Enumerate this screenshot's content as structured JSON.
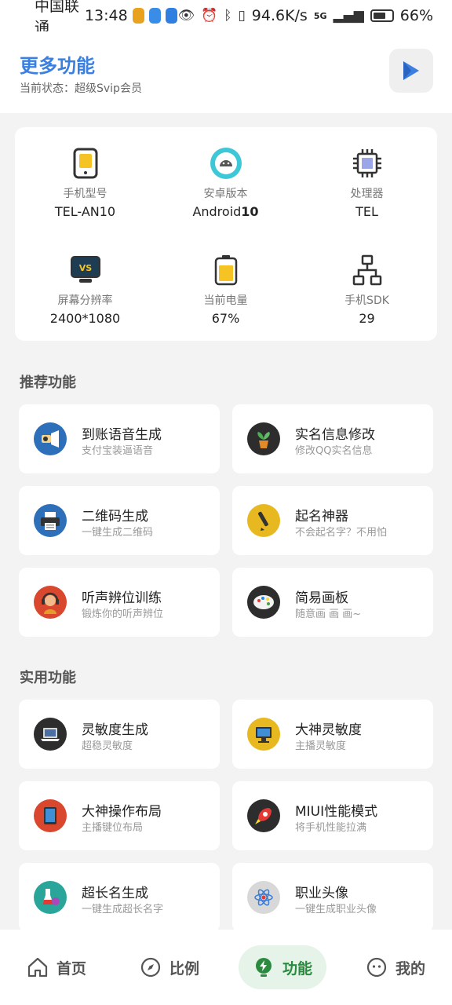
{
  "status_bar": {
    "carrier": "中国联通",
    "time": "13:48",
    "speed": "94.6K/s",
    "network": "5G",
    "battery": "66%"
  },
  "header": {
    "title": "更多功能",
    "subtitle": "当前状态：超级Svip会员"
  },
  "device_info": [
    {
      "label": "手机型号",
      "value": "TEL-AN10",
      "icon": "phone-icon"
    },
    {
      "label": "安卓版本",
      "value_prefix": "Android",
      "value_bold": "10",
      "icon": "android-icon"
    },
    {
      "label": "处理器",
      "value": "TEL",
      "icon": "chip-icon"
    },
    {
      "label": "屏幕分辨率",
      "value": "2400*1080",
      "icon": "screen-icon"
    },
    {
      "label": "当前电量",
      "value": "67%",
      "icon": "battery-icon"
    },
    {
      "label": "手机SDK",
      "value": "29",
      "icon": "network-icon"
    }
  ],
  "sections": {
    "recommended": "推荐功能",
    "practical": "实用功能"
  },
  "recommended": [
    {
      "title": "到账语音生成",
      "subtitle": "支付宝装逼语音",
      "icon": "megaphone-icon"
    },
    {
      "title": "实名信息修改",
      "subtitle": "修改QQ实名信息",
      "icon": "plant-icon"
    },
    {
      "title": "二维码生成",
      "subtitle": "一键生成二维码",
      "icon": "printer-icon"
    },
    {
      "title": "起名神器",
      "subtitle": "不会起名字？不用怕",
      "icon": "pen-icon"
    },
    {
      "title": "听声辨位训练",
      "subtitle": "锻炼你的听声辨位",
      "icon": "headphone-person-icon"
    },
    {
      "title": "简易画板",
      "subtitle": "随意画 画 画~",
      "icon": "palette-icon"
    }
  ],
  "practical": [
    {
      "title": "灵敏度生成",
      "subtitle": "超稳灵敏度",
      "icon": "laptop-icon"
    },
    {
      "title": "大神灵敏度",
      "subtitle": "主播灵敏度",
      "icon": "computer-icon"
    },
    {
      "title": "大神操作布局",
      "subtitle": "主播键位布局",
      "icon": "tablet-icon"
    },
    {
      "title": "MIUI性能模式",
      "subtitle": "将手机性能拉满",
      "icon": "rocket-icon"
    },
    {
      "title": "超长名生成",
      "subtitle": "一键生成超长名字",
      "icon": "flask-icon"
    },
    {
      "title": "职业头像",
      "subtitle": "一键生成职业头像",
      "icon": "atom-icon"
    }
  ],
  "nav": [
    {
      "label": "首页",
      "icon": "home-icon"
    },
    {
      "label": "比例",
      "icon": "compass-icon"
    },
    {
      "label": "功能",
      "icon": "bolt-icon",
      "active": true
    },
    {
      "label": "我的",
      "icon": "face-icon"
    }
  ],
  "colors": {
    "accent": "#3b7fe0",
    "nav_active_bg": "#e5f3e8",
    "nav_active_text": "#2a8a3e"
  }
}
